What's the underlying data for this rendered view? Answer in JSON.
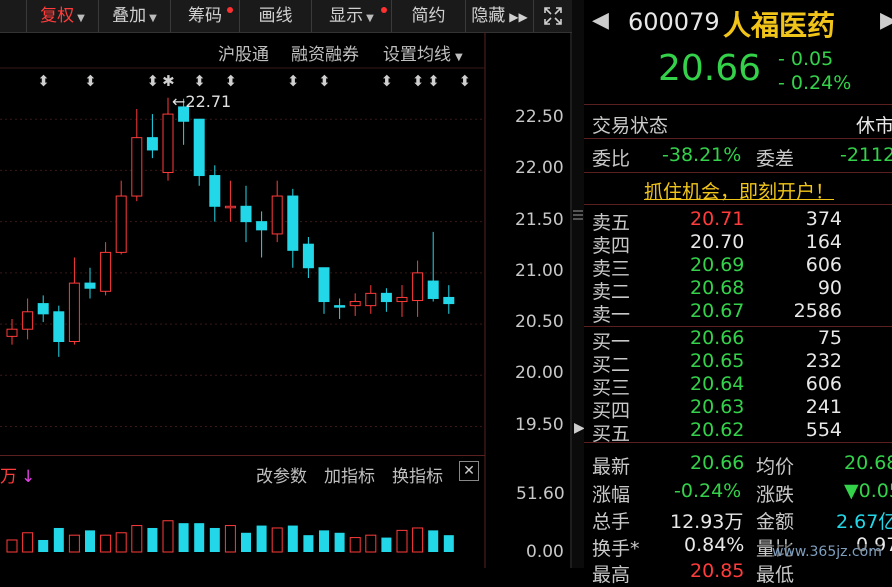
{
  "toolbar": {
    "fuquan": "复权",
    "diejia": "叠加",
    "chouma": "筹码",
    "huaxian": "画线",
    "xianshi": "显示",
    "jianyue": "简约",
    "yincang": "隐藏"
  },
  "chart": {
    "links": [
      "沪股通",
      "融资融券",
      "设置均线"
    ],
    "high_annotation": "22.71",
    "y_ticks": [
      "22.50",
      "22.00",
      "21.50",
      "21.00",
      "20.50",
      "20.00",
      "19.50"
    ],
    "vol_ticks": [
      "51.60",
      "0.00"
    ],
    "vol_label": "万",
    "vol_buttons": [
      "改参数",
      "加指标",
      "换指标"
    ]
  },
  "chart_data": {
    "type": "candlestick",
    "ylim": [
      19.3,
      23.0
    ],
    "candles": [
      {
        "o": 20.38,
        "c": 20.45,
        "h": 20.55,
        "l": 20.3,
        "up": true
      },
      {
        "o": 20.45,
        "c": 20.62,
        "h": 20.75,
        "l": 20.35,
        "up": true
      },
      {
        "o": 20.7,
        "c": 20.6,
        "h": 20.78,
        "l": 20.52,
        "up": false
      },
      {
        "o": 20.62,
        "c": 20.33,
        "h": 20.68,
        "l": 20.18,
        "up": false
      },
      {
        "o": 20.33,
        "c": 20.9,
        "h": 21.15,
        "l": 20.3,
        "up": true
      },
      {
        "o": 20.9,
        "c": 20.85,
        "h": 21.05,
        "l": 20.75,
        "up": false
      },
      {
        "o": 20.82,
        "c": 21.2,
        "h": 21.3,
        "l": 20.78,
        "up": true
      },
      {
        "o": 21.2,
        "c": 21.75,
        "h": 21.9,
        "l": 21.18,
        "up": true
      },
      {
        "o": 21.75,
        "c": 22.32,
        "h": 22.6,
        "l": 21.7,
        "up": true
      },
      {
        "o": 22.32,
        "c": 22.2,
        "h": 22.55,
        "l": 22.12,
        "up": false
      },
      {
        "o": 21.98,
        "c": 22.55,
        "h": 22.71,
        "l": 21.9,
        "up": true
      },
      {
        "o": 22.62,
        "c": 22.48,
        "h": 22.7,
        "l": 22.25,
        "up": false
      },
      {
        "o": 22.5,
        "c": 21.95,
        "h": 22.5,
        "l": 21.85,
        "up": false
      },
      {
        "o": 21.95,
        "c": 21.65,
        "h": 22.05,
        "l": 21.5,
        "up": false
      },
      {
        "o": 21.65,
        "c": 21.65,
        "h": 21.9,
        "l": 21.5,
        "up": true
      },
      {
        "o": 21.65,
        "c": 21.5,
        "h": 21.85,
        "l": 21.3,
        "up": false
      },
      {
        "o": 21.5,
        "c": 21.42,
        "h": 21.6,
        "l": 21.15,
        "up": false
      },
      {
        "o": 21.38,
        "c": 21.75,
        "h": 21.9,
        "l": 21.3,
        "up": true
      },
      {
        "o": 21.75,
        "c": 21.22,
        "h": 21.82,
        "l": 21.05,
        "up": false
      },
      {
        "o": 21.28,
        "c": 21.05,
        "h": 21.35,
        "l": 20.95,
        "up": false
      },
      {
        "o": 21.05,
        "c": 20.72,
        "h": 21.05,
        "l": 20.6,
        "up": false
      },
      {
        "o": 20.68,
        "c": 20.68,
        "h": 20.75,
        "l": 20.55,
        "up": false
      },
      {
        "o": 20.68,
        "c": 20.72,
        "h": 20.8,
        "l": 20.58,
        "up": true
      },
      {
        "o": 20.68,
        "c": 20.8,
        "h": 20.88,
        "l": 20.6,
        "up": true
      },
      {
        "o": 20.8,
        "c": 20.72,
        "h": 20.85,
        "l": 20.62,
        "up": false
      },
      {
        "o": 20.72,
        "c": 20.76,
        "h": 20.88,
        "l": 20.57,
        "up": true
      },
      {
        "o": 20.73,
        "c": 21.0,
        "h": 21.12,
        "l": 20.57,
        "up": true
      },
      {
        "o": 20.92,
        "c": 20.75,
        "h": 21.4,
        "l": 20.72,
        "up": false
      },
      {
        "o": 20.76,
        "c": 20.7,
        "h": 20.88,
        "l": 20.6,
        "up": false
      }
    ],
    "volume_ylim": [
      0,
      51.6
    ],
    "volumes": [
      10,
      16,
      10,
      20,
      14,
      18,
      14,
      16,
      22,
      20,
      26,
      24,
      24,
      20,
      22,
      16,
      22,
      20,
      22,
      14,
      18,
      16,
      12,
      14,
      12,
      18,
      20,
      18,
      14
    ]
  },
  "quote": {
    "code": "600079",
    "name": "人福医药",
    "price": "20.66",
    "change": "- 0.05",
    "change_pct": "- 0.24%",
    "trade_status_label": "交易状态",
    "trade_status": "休市",
    "weibi_label": "委比",
    "weibi": "-38.21%",
    "weicha_label": "委差",
    "weicha": "-2112",
    "promo": "抓住机会，即刻开户！"
  },
  "orderbook": {
    "asks": [
      {
        "label": "卖五",
        "price": "20.71",
        "vol": "374",
        "color": "#ff3b3b"
      },
      {
        "label": "卖四",
        "price": "20.70",
        "vol": "164",
        "color": "#e8e8e8"
      },
      {
        "label": "卖三",
        "price": "20.69",
        "vol": "606",
        "color": "#33d24a"
      },
      {
        "label": "卖二",
        "price": "20.68",
        "vol": "90",
        "color": "#33d24a"
      },
      {
        "label": "卖一",
        "price": "20.67",
        "vol": "2586",
        "color": "#33d24a"
      }
    ],
    "bids": [
      {
        "label": "买一",
        "price": "20.66",
        "vol": "75",
        "color": "#33d24a"
      },
      {
        "label": "买二",
        "price": "20.65",
        "vol": "232",
        "color": "#33d24a"
      },
      {
        "label": "买三",
        "price": "20.64",
        "vol": "606",
        "color": "#33d24a"
      },
      {
        "label": "买四",
        "price": "20.63",
        "vol": "241",
        "color": "#33d24a"
      },
      {
        "label": "买五",
        "price": "20.62",
        "vol": "554",
        "color": "#33d24a"
      }
    ]
  },
  "stats": {
    "latest_label": "最新",
    "latest": "20.66",
    "avg_label": "均价",
    "avg": "20.68",
    "zhangfu_label": "涨幅",
    "zhangfu": "-0.24%",
    "zhangdie_label": "涨跌",
    "zhangdie": "▼0.05",
    "zongshou_label": "总手",
    "zongshou": "12.93万",
    "jine_label": "金额",
    "jine": "2.67亿",
    "huanshou_label": "换手*",
    "huanshou": "0.84%",
    "liangbi_label": "量比",
    "liangbi": "0.97",
    "zuigao_label": "最高",
    "zuigao": "20.85",
    "zuidi_label": "最低"
  },
  "watermark": "www.365jz.com",
  "colors": {
    "up": "#ff3b3b",
    "down": "#22d8e8",
    "accent_red": "#ff3b3b",
    "green": "#33d24a"
  }
}
